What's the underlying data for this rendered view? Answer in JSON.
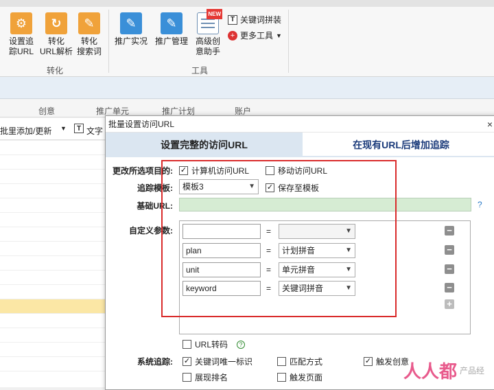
{
  "ribbon": {
    "buttons": [
      {
        "label": "设置追\n踪URL",
        "icon": "gear-icon"
      },
      {
        "label": "转化\nURL解析",
        "icon": "refresh-icon"
      },
      {
        "label": "转化\n搜索词",
        "icon": "edit-icon"
      },
      {
        "label": "推广实况",
        "icon": "edit-icon"
      },
      {
        "label": "推广管理",
        "icon": "edit-icon"
      },
      {
        "label": "高级创\n意助手",
        "icon": "document-icon",
        "badge": "NEW"
      }
    ],
    "small_tools": [
      {
        "label": "关键词拼装",
        "icon": "text-t-icon"
      },
      {
        "label": "更多工具",
        "icon": "plus-circle-icon"
      }
    ],
    "groups": [
      "转化",
      "工具"
    ]
  },
  "background": {
    "columns": [
      "创意",
      "推广单元",
      "推广计划",
      "账户"
    ],
    "toolbar_label": "批里添加/更新",
    "toolbar_label2": "文字"
  },
  "dialog": {
    "title": "批量设置访问URL",
    "close": "×",
    "tabs": [
      "设置完整的访问URL",
      "在现有URL后增加追踪"
    ],
    "labels": {
      "change_items": "更改所选项目的:",
      "template": "追踪模板:",
      "base_url": "基础URL:",
      "custom_params": "自定义参数:",
      "system_tracking": "系统追踪:"
    },
    "checkboxes": {
      "pc_url": {
        "label": "计算机访问URL",
        "checked": true
      },
      "mobile_url": {
        "label": "移动访问URL",
        "checked": false
      },
      "save_template": {
        "label": "保存至模板",
        "checked": true
      },
      "url_encode": {
        "label": "URL转码",
        "checked": false
      },
      "keyword_id": {
        "label": "关键词唯一标识",
        "checked": true
      },
      "match_type": {
        "label": "匹配方式",
        "checked": false
      },
      "trigger_word": {
        "label": "触发创意",
        "checked": true
      },
      "rank": {
        "label": "展现排名",
        "checked": false
      },
      "trigger_page": {
        "label": "触发页面",
        "checked": false
      }
    },
    "template_value": "模板3",
    "base_url_value": "",
    "base_url_help": "?",
    "url_encode_help": "?",
    "params": [
      {
        "name": "",
        "value": ""
      },
      {
        "name": "plan",
        "value": "计划拼音"
      },
      {
        "name": "unit",
        "value": "单元拼音"
      },
      {
        "name": "keyword",
        "value": "关键词拼音"
      }
    ],
    "eq": "=",
    "minus": "−",
    "plus": "+"
  },
  "watermark": {
    "big": "人人都",
    "small": "产品经"
  },
  "colors": {
    "highlight_box": "#d92b2b",
    "active_tab": "#dbe6f1",
    "base_url_bg": "#d6ecd3",
    "ribbon_orange": "#f0a23a",
    "ribbon_blue": "#3a8fd8"
  }
}
